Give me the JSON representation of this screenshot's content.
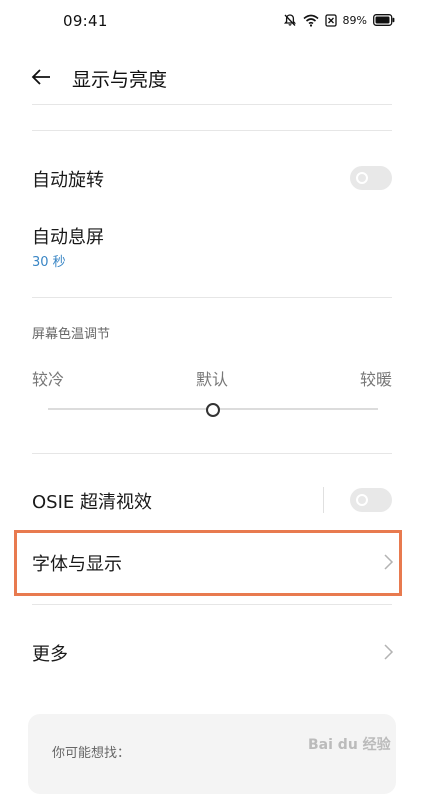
{
  "status_bar": {
    "time": "09:41",
    "battery": "89%"
  },
  "header": {
    "title": "显示与亮度"
  },
  "settings": {
    "auto_rotate": {
      "label": "自动旋转",
      "enabled": false
    },
    "screen_timeout": {
      "label": "自动息屏",
      "value": "30 秒"
    },
    "color_temperature": {
      "section_label": "屏幕色温调节",
      "cool_label": "较冷",
      "default_label": "默认",
      "warm_label": "较暖",
      "level": 0.5
    },
    "osie": {
      "label": "OSIE 超清视效",
      "enabled": false
    },
    "font_display": {
      "label": "字体与显示"
    },
    "more": {
      "label": "更多"
    }
  },
  "suggestions": {
    "title": "你可能想找："
  },
  "watermark": {
    "text": "Bai du 经验"
  },
  "colors": {
    "accent_link": "#3a86c5",
    "highlight_border": "#e87a4f",
    "toggle_off": "#e8e8e8"
  }
}
